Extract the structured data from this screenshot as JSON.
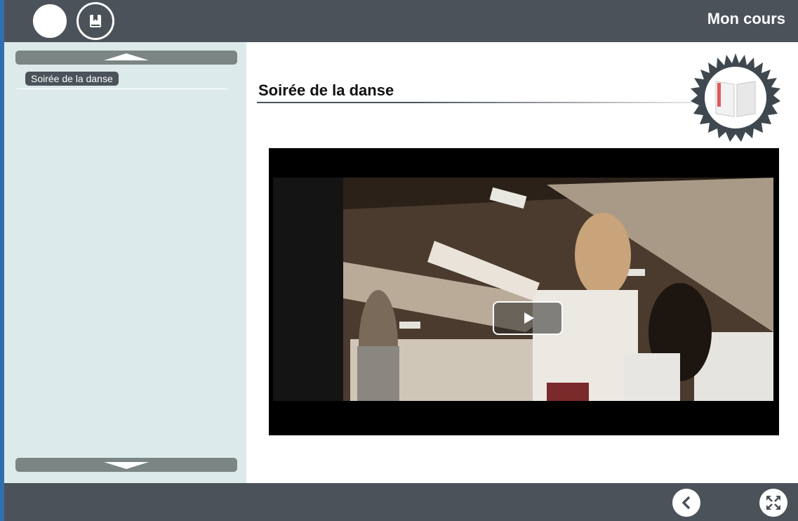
{
  "header": {
    "title": "Mon cours",
    "home_icon": "home-icon",
    "bookmark_icon": "bookmark-book-icon"
  },
  "sidebar": {
    "items": [
      {
        "label": "Soirée de la danse",
        "selected": true
      }
    ],
    "scroll_up_icon": "triangle-up-icon",
    "scroll_down_icon": "triangle-down-icon"
  },
  "main": {
    "title": "Soirée de la danse",
    "badge_icon": "book-badge-icon",
    "video": {
      "play_icon": "play-icon"
    }
  },
  "footer": {
    "prev_icon": "chevron-left-icon",
    "fullscreen_icon": "fullscreen-icon"
  },
  "colors": {
    "bar": "#4b525a",
    "sidebar": "#dceaea",
    "accent_left_edge": "#2f6fb0",
    "bookmark_ribbon": "#e05a5a"
  }
}
